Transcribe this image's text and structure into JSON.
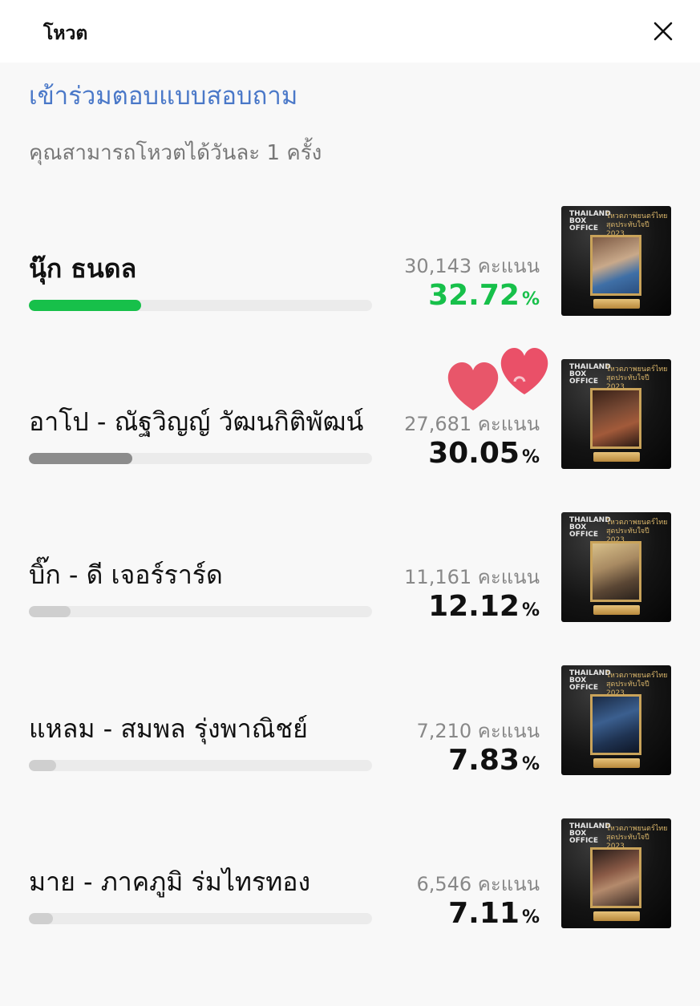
{
  "header": {
    "title": "โหวต",
    "close_label": "ปิด"
  },
  "survey_link": "เข้าร่วมตอบแบบสอบถาม",
  "notice": "คุณสามารถโหวตได้วันละ 1 ครั้ง",
  "thumbnail": {
    "brand": "THAILAND BOX OFFICE",
    "tagline": "โหวตภาพยนตร์ไทย สุดประทับใจปี 2023",
    "badge": "นักแสดงแห่งปี"
  },
  "colors": {
    "leader": "#17c04a",
    "second": "#8c8c8c",
    "rest": "#cfcfcf",
    "link": "#4a78c8"
  },
  "candidates": [
    {
      "name": "นุ๊ก ธนดล",
      "score": "30,143 คะแนน",
      "percent": "32.72",
      "percent_symbol": "%",
      "share": 0.3272,
      "leader": true
    },
    {
      "name": "อาโป - ณัฐวิญญ์ วัฒนกิติพัฒน์",
      "score": "27,681 คะแนน",
      "percent": "30.05",
      "percent_symbol": "%",
      "share": 0.3005,
      "leader": false
    },
    {
      "name": "บิ๊ก - ดี เจอร์ราร์ด",
      "score": "11,161 คะแนน",
      "percent": "12.12",
      "percent_symbol": "%",
      "share": 0.1212,
      "leader": false
    },
    {
      "name": "แหลม - สมพล รุ่งพาณิชย์",
      "score": "7,210 คะแนน",
      "percent": "7.83",
      "percent_symbol": "%",
      "share": 0.0783,
      "leader": false
    },
    {
      "name": "มาย - ภาคภูมิ ร่มไทรทอง",
      "score": "6,546 คะแนน",
      "percent": "7.11",
      "percent_symbol": "%",
      "share": 0.0711,
      "leader": false
    }
  ]
}
